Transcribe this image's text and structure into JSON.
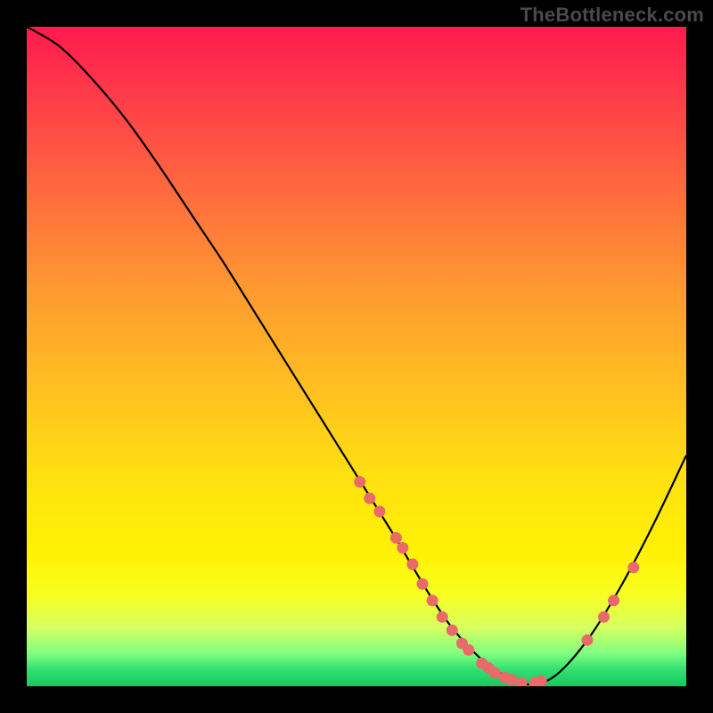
{
  "watermark": "TheBottleneck.com",
  "chart_data": {
    "type": "line",
    "title": "",
    "xlabel": "",
    "ylabel": "",
    "xlim": [
      0,
      100
    ],
    "ylim": [
      0,
      100
    ],
    "series": [
      {
        "name": "curve",
        "x": [
          0,
          5,
          10,
          15,
          20,
          25,
          30,
          35,
          40,
          45,
          50,
          55,
          58,
          61,
          64,
          67,
          70,
          73,
          76,
          80,
          85,
          90,
          95,
          100
        ],
        "y": [
          100,
          97,
          92,
          86,
          79,
          71.5,
          64,
          56,
          48,
          40,
          32,
          24,
          19,
          14,
          9.5,
          6,
          3.2,
          1.3,
          0.3,
          1.5,
          7,
          15,
          24.5,
          35
        ]
      }
    ],
    "scatter": {
      "name": "datapoints",
      "color": "#e86a6a",
      "points": [
        {
          "x": 50.5,
          "y": 31
        },
        {
          "x": 52,
          "y": 28.5
        },
        {
          "x": 53.5,
          "y": 26.5
        },
        {
          "x": 56,
          "y": 22.5
        },
        {
          "x": 57,
          "y": 21
        },
        {
          "x": 58.5,
          "y": 18.5
        },
        {
          "x": 60,
          "y": 15.5
        },
        {
          "x": 61.5,
          "y": 13
        },
        {
          "x": 63,
          "y": 10.5
        },
        {
          "x": 64.5,
          "y": 8.5
        },
        {
          "x": 66,
          "y": 6.5
        },
        {
          "x": 67,
          "y": 5.5
        },
        {
          "x": 69,
          "y": 3.5
        },
        {
          "x": 70,
          "y": 2.8
        },
        {
          "x": 71,
          "y": 2
        },
        {
          "x": 72.5,
          "y": 1.3
        },
        {
          "x": 73.5,
          "y": 1
        },
        {
          "x": 75,
          "y": 0.5
        },
        {
          "x": 77,
          "y": 0.5
        },
        {
          "x": 78,
          "y": 0.8
        },
        {
          "x": 85,
          "y": 7
        },
        {
          "x": 87.5,
          "y": 10.5
        },
        {
          "x": 89,
          "y": 13
        },
        {
          "x": 92,
          "y": 18
        }
      ]
    }
  }
}
